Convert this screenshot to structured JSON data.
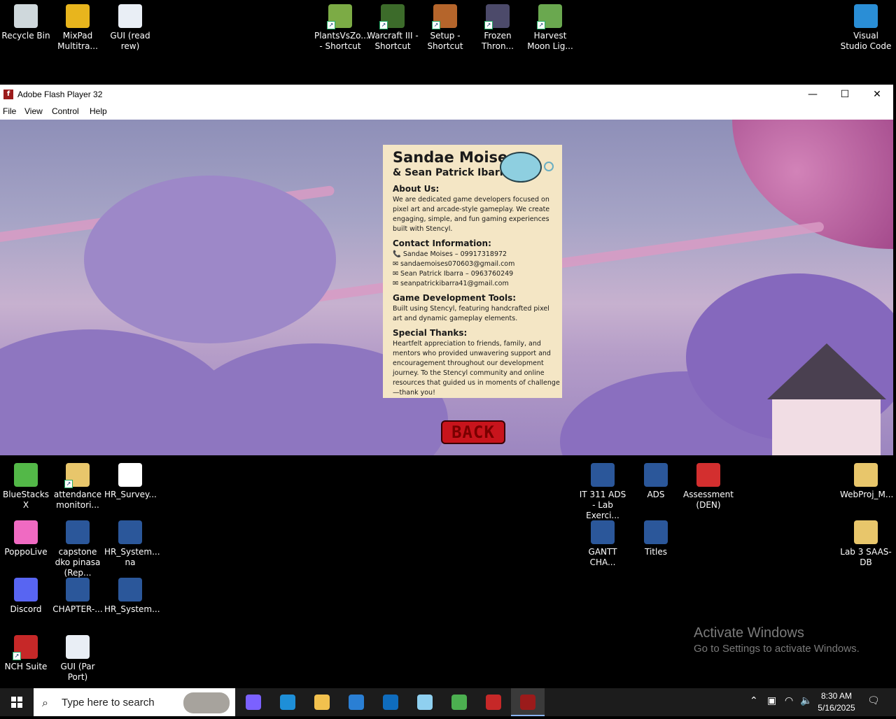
{
  "desktop": {
    "top_icons": [
      {
        "label": "Recycle Bin",
        "icon": "recycle-bin-icon",
        "color": "#cfd8dc"
      },
      {
        "label": "MixPad Multitra...",
        "icon": "mixpad-icon",
        "color": "#e8b51d"
      },
      {
        "label": "GUI (read rew)",
        "icon": "gui-file-icon",
        "color": "#e9eef5"
      },
      {
        "label": "PlantsVsZo... - Shortcut",
        "icon": "plants-vs-zombies-icon",
        "color": "#7cab45"
      },
      {
        "label": "Warcraft III - Shortcut",
        "icon": "warcraft-icon",
        "color": "#3c6b2a"
      },
      {
        "label": "Setup - Shortcut",
        "icon": "setup-icon",
        "color": "#b5652b"
      },
      {
        "label": "Frozen Thron...",
        "icon": "frozen-throne-icon",
        "color": "#4c4a6a"
      },
      {
        "label": "Harvest Moon Lig...",
        "icon": "harvest-moon-icon",
        "color": "#6aa84f"
      },
      {
        "label": "Visual Studio Code",
        "icon": "vscode-icon",
        "color": "#2a8ed6"
      }
    ],
    "left_icons": [
      {
        "label": "BlueStacks X",
        "icon": "bluestacks-icon",
        "color": "#53b848"
      },
      {
        "label": "attendance monitori...",
        "icon": "folder-icon",
        "color": "#e8c66b"
      },
      {
        "label": "HR_Survey...",
        "icon": "blank-file-icon",
        "color": "#ffffff"
      },
      {
        "label": "PoppoLive",
        "icon": "poppolive-icon",
        "color": "#f06ac2"
      },
      {
        "label": "capstone dko pinasa (Rep...",
        "icon": "word-doc-icon",
        "color": "#2b579a"
      },
      {
        "label": "HR_System... na",
        "icon": "word-doc-icon",
        "color": "#2b579a"
      },
      {
        "label": "Discord",
        "icon": "discord-icon",
        "color": "#5865f2"
      },
      {
        "label": "CHAPTER-...",
        "icon": "word-doc-icon",
        "color": "#2b579a"
      },
      {
        "label": "HR_System...",
        "icon": "word-doc-icon",
        "color": "#2b579a"
      },
      {
        "label": "NCH Suite",
        "icon": "nch-suite-icon",
        "color": "#c62828"
      },
      {
        "label": "GUI (Par Port)",
        "icon": "gui-file-icon",
        "color": "#e9eef5"
      }
    ],
    "right_icons": [
      {
        "label": "IT 311 ADS - Lab Exerci...",
        "icon": "word-doc-icon",
        "color": "#2b579a"
      },
      {
        "label": "ADS",
        "icon": "word-doc-icon",
        "color": "#2b579a"
      },
      {
        "label": "Assessment (DEN)",
        "icon": "pdf-icon",
        "color": "#d32f2f"
      },
      {
        "label": "WebProj_M...",
        "icon": "folder-icon",
        "color": "#e8c66b"
      },
      {
        "label": "GANTT CHA...",
        "icon": "word-doc-icon",
        "color": "#2b579a"
      },
      {
        "label": "Titles",
        "icon": "word-doc-icon",
        "color": "#2b579a"
      },
      {
        "label": "Lab 3 SAAS-DB",
        "icon": "folder-icon",
        "color": "#e8c66b"
      }
    ]
  },
  "window": {
    "title": "Adobe Flash Player 32",
    "menu": [
      "File",
      "View",
      "Control",
      "Help"
    ],
    "minimize": "—",
    "maximize": "☐",
    "close": "✕"
  },
  "credits": {
    "name1": "Sandae Moises",
    "name2": "& Sean Patrick Ibarra",
    "about_heading": "About Us:",
    "about_text": "We are dedicated game developers focused on pixel art and arcade-style gameplay. We create engaging, simple, and fun gaming experiences built with Stencyl.",
    "contact_heading": "Contact Information:",
    "contacts": [
      "📞 Sandae Moises – 09917318972",
      "✉ sandaemoises070603@gmail.com",
      "✉ Sean Patrick Ibarra – 0963760249",
      "✉ seanpatrickibarra41@gmail.com"
    ],
    "tools_heading": "Game Development Tools:",
    "tools_text": "Built using Stencyl, featuring handcrafted pixel art and dynamic gameplay elements.",
    "thanks_heading": "Special Thanks:",
    "thanks_text": "Heartfelt appreciation to friends, family, and mentors who provided unwavering support and encouragement throughout our development journey. To the Stencyl community and online resources that guided us in moments of challenge—thank you!",
    "back_label": "BACK"
  },
  "watermark": {
    "line1": "Activate Windows",
    "line2": "Go to Settings to activate Windows."
  },
  "taskbar": {
    "search_placeholder": "Type here to search",
    "apps": [
      {
        "icon": "copilot-icon",
        "color": "#7b61ff"
      },
      {
        "icon": "edge-icon",
        "color": "#1e8fd8"
      },
      {
        "icon": "file-explorer-icon",
        "color": "#f2c14e"
      },
      {
        "icon": "microsoft-store-icon",
        "color": "#2a7fd4"
      },
      {
        "icon": "outlook-icon",
        "color": "#0f6cbd"
      },
      {
        "icon": "game-app-icon",
        "color": "#8fd0f0"
      },
      {
        "icon": "chrome-icon",
        "color": "#4caf50"
      },
      {
        "icon": "capcut-icon",
        "color": "#c62828"
      },
      {
        "icon": "flash-player-icon",
        "color": "#9b1b1b"
      }
    ],
    "time": "8:30 AM",
    "date": "5/16/2025"
  }
}
